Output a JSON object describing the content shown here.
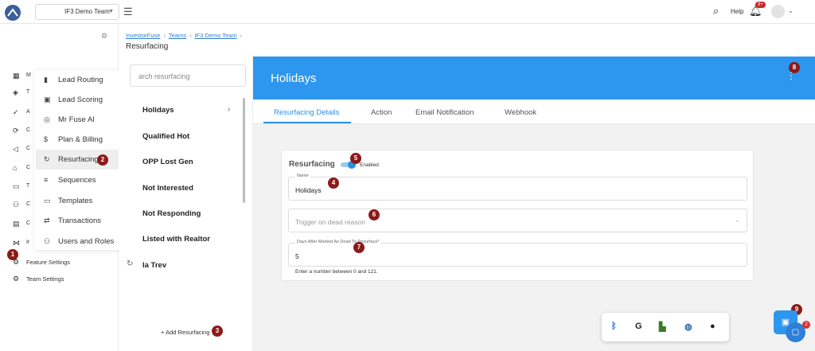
{
  "topbar": {
    "team_select": "IF3 Demo Team",
    "help_label": "Help",
    "notifications_badge": "9+",
    "icons": [
      "app-logo-icon",
      "menu-icon",
      "search-icon",
      "bell-icon",
      "avatar-icon",
      "chevron-down-icon"
    ]
  },
  "leftrail": {
    "items": [
      {
        "icon": "grid-icon",
        "label": "M"
      },
      {
        "icon": "layers-icon",
        "label": "T"
      },
      {
        "icon": "check-circle-icon",
        "label": "A"
      },
      {
        "icon": "sync-icon",
        "label": "C"
      },
      {
        "icon": "megaphone-icon",
        "label": "C"
      },
      {
        "icon": "home-icon",
        "label": "C"
      },
      {
        "icon": "money-icon",
        "label": "T"
      },
      {
        "icon": "people-icon",
        "label": "C"
      },
      {
        "icon": "calendar-icon",
        "label": "C"
      },
      {
        "icon": "share-icon",
        "label": "Ir"
      }
    ],
    "feature_settings": "Feature Settings",
    "team_settings": "Team Settings"
  },
  "submenu": {
    "items": [
      {
        "icon": "bar-chart-icon",
        "label": "Lead Routing"
      },
      {
        "icon": "scoring-icon",
        "label": "Lead Scoring"
      },
      {
        "icon": "lifebuoy-icon",
        "label": "Mr Fuse AI"
      },
      {
        "icon": "dollar-icon",
        "label": "Plan & Billing"
      },
      {
        "icon": "refresh-icon",
        "label": "Resurfacing"
      },
      {
        "icon": "sequence-icon",
        "label": "Sequences"
      },
      {
        "icon": "template-icon",
        "label": "Templates"
      },
      {
        "icon": "transactions-icon",
        "label": "Transactions"
      },
      {
        "icon": "users-icon",
        "label": "Users and Roles"
      }
    ],
    "active": "Resurfacing"
  },
  "breadcrumb": {
    "items": [
      "InvestorFuse",
      "Teams",
      "IF3 Demo Team"
    ],
    "title": "Resurfacing"
  },
  "list": {
    "search_placeholder": "arch resurfacing",
    "items": [
      "Holidays",
      "Qualified Hot",
      "OPP Lost Gen",
      "Not Interested",
      "Not Responding",
      "Listed with Realtor",
      "la Trev"
    ],
    "add_label": "Add Resurfacing"
  },
  "main": {
    "title": "Holidays",
    "tabs": [
      "Resurfacing Details",
      "Action",
      "Email Notification",
      "Webhook"
    ],
    "active_tab": "Resurfacing Details",
    "card": {
      "title": "Resurfacing",
      "toggle_label": "Enabled",
      "toggle_on": true,
      "name_label": "Name",
      "name_value": "Holidays",
      "trigger_placeholder": "Trigger on dead reason",
      "days_label": "Days After Marked As Dead To Resurface*",
      "days_value": "5",
      "hint": "Enter a number between 0 and 121."
    }
  },
  "annotations": [
    "1",
    "2",
    "3",
    "4",
    "5",
    "6",
    "7",
    "8",
    "9"
  ],
  "dock": {
    "icons": [
      "bluetooth-icon",
      "grammarly-icon",
      "app-icon",
      "vpn-icon",
      "app2-icon"
    ]
  },
  "chat_badge": "2",
  "colors": {
    "accent": "#2d96ee",
    "badge": "#8b1a1a"
  }
}
